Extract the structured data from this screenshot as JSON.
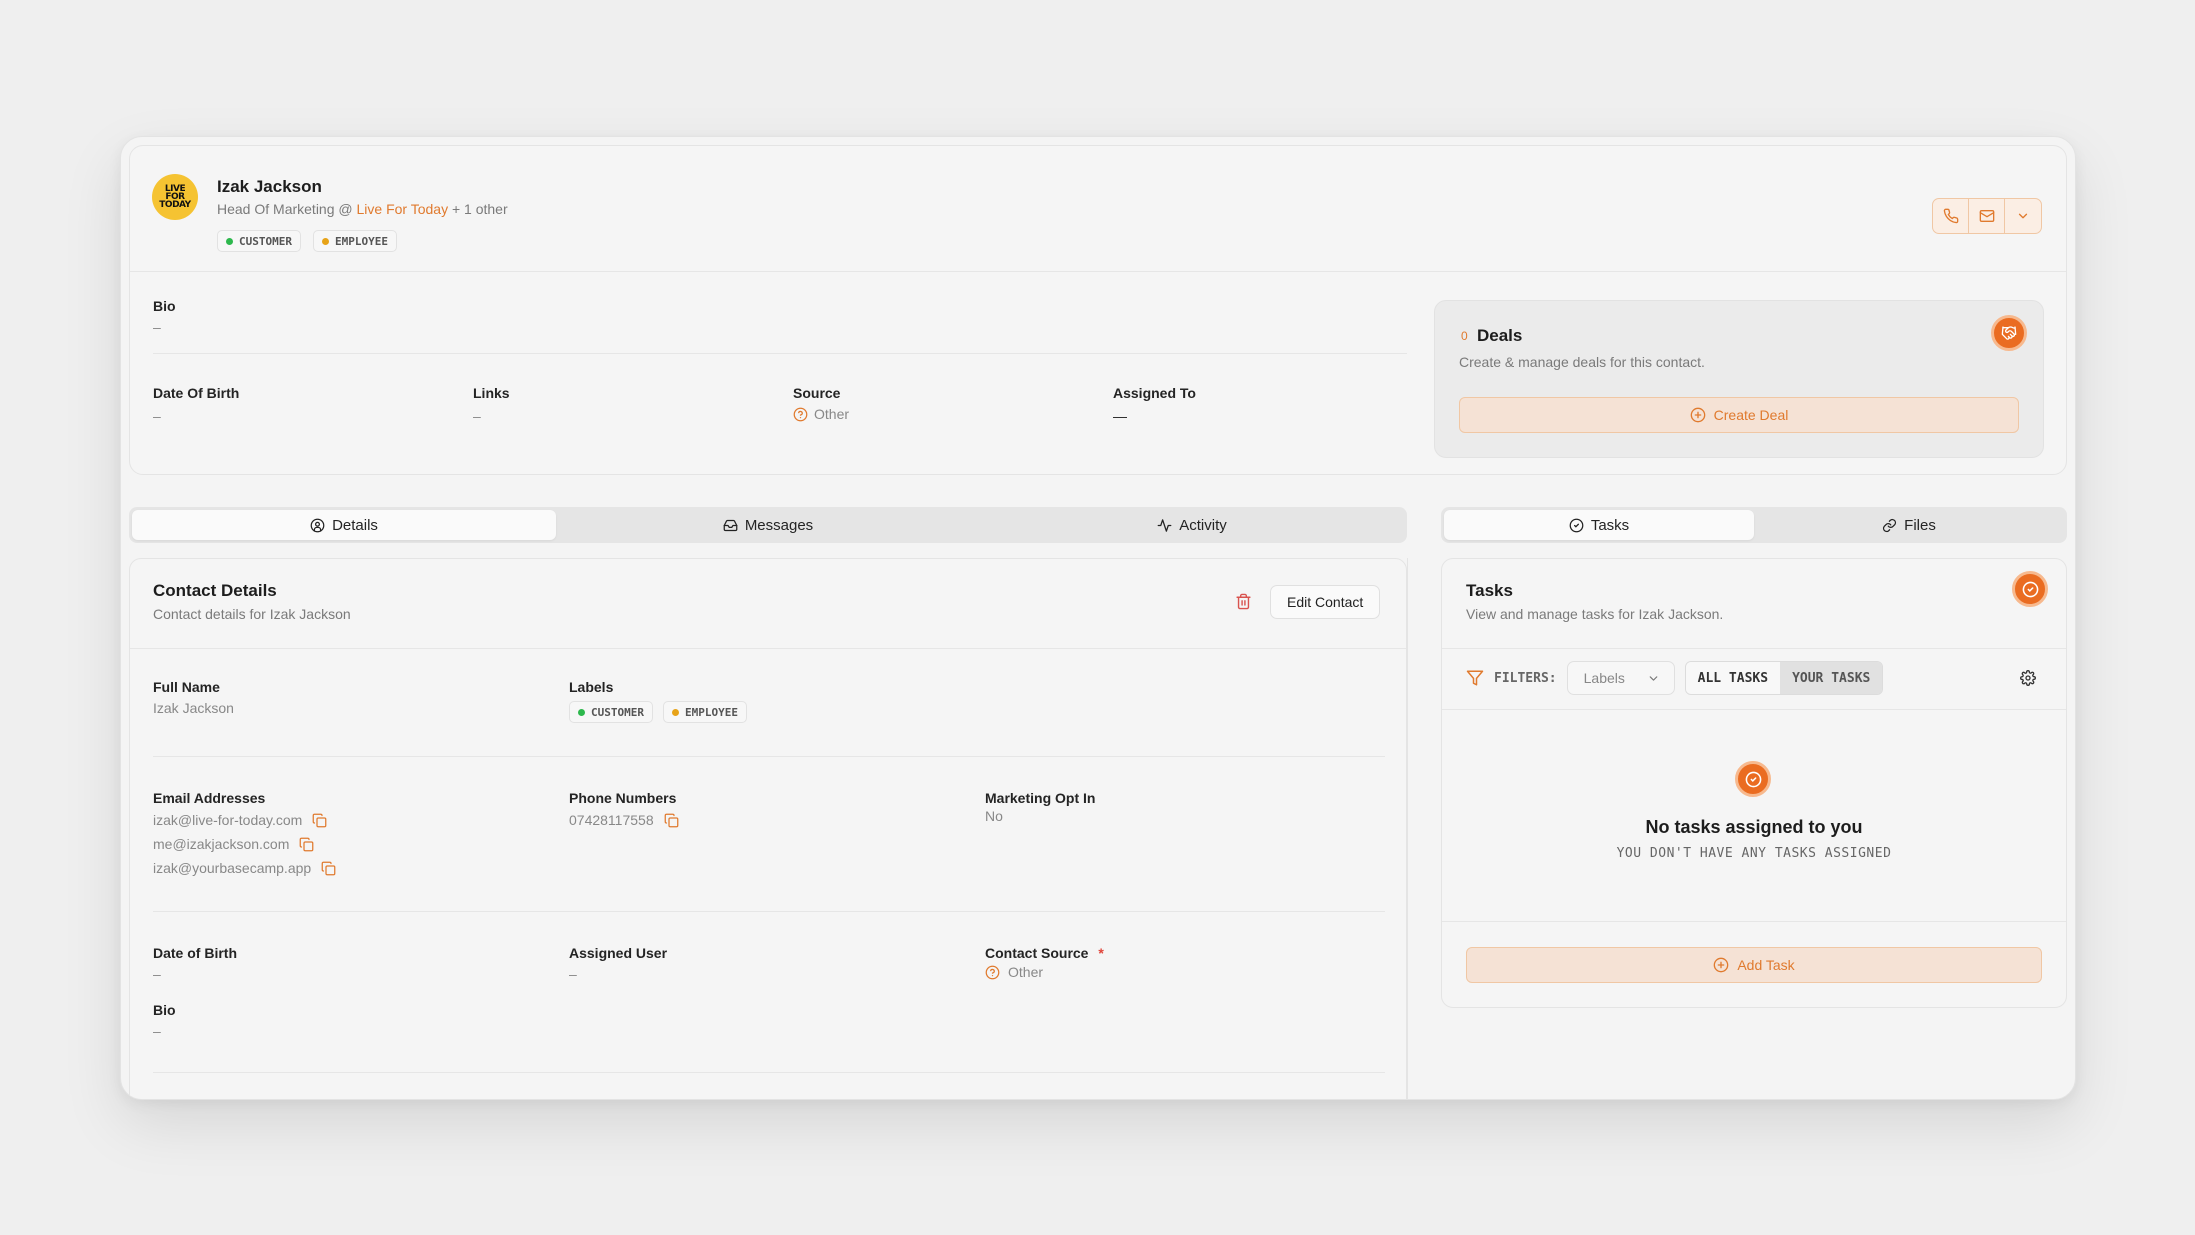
{
  "contact": {
    "name": "Izak Jackson",
    "role_prefix": "Head Of Marketing @ ",
    "company": "Live For Today",
    "role_suffix": " + 1 other",
    "avatar_text": "LIVE FOR TODAY",
    "labels": [
      {
        "text": "CUSTOMER",
        "color": "#2db84d"
      },
      {
        "text": "EMPLOYEE",
        "color": "#e7a318"
      }
    ]
  },
  "header_actions": {
    "icons": [
      "phone-icon",
      "mail-icon",
      "chevron-down-icon"
    ]
  },
  "summary": {
    "bio_label": "Bio",
    "bio_value": "–",
    "dob_label": "Date Of Birth",
    "dob_value": "–",
    "links_label": "Links",
    "links_value": "–",
    "source_label": "Source",
    "source_value": "Other",
    "assigned_label": "Assigned To",
    "assigned_value": "—"
  },
  "deals": {
    "count": "0",
    "title": "Deals",
    "description": "Create & manage deals for this contact.",
    "button": "Create Deal"
  },
  "left_tabs": [
    {
      "label": "Details",
      "icon": "user-circle-icon",
      "active": true
    },
    {
      "label": "Messages",
      "icon": "inbox-icon",
      "active": false
    },
    {
      "label": "Activity",
      "icon": "activity-icon",
      "active": false
    }
  ],
  "right_tabs": [
    {
      "label": "Tasks",
      "icon": "check-circle-icon",
      "active": true
    },
    {
      "label": "Files",
      "icon": "link-icon",
      "active": false
    }
  ],
  "contact_details": {
    "title": "Contact Details",
    "subtitle": "Contact details for Izak Jackson",
    "edit_button": "Edit Contact",
    "full_name_label": "Full Name",
    "full_name_value": "Izak Jackson",
    "labels_label": "Labels",
    "email_label": "Email Addresses",
    "emails": [
      "izak@live-for-today.com",
      "me@izakjackson.com",
      "izak@yourbasecamp.app"
    ],
    "phone_label": "Phone Numbers",
    "phones": [
      "07428117558"
    ],
    "marketing_label": "Marketing Opt In",
    "marketing_value": "No",
    "dob_label": "Date of Birth",
    "dob_value": "–",
    "assigned_label": "Assigned User",
    "assigned_value": "–",
    "source_label": "Contact Source",
    "source_required": "*",
    "source_value": "Other",
    "bio_label": "Bio",
    "bio_value": "–"
  },
  "tasks": {
    "title": "Tasks",
    "subtitle": "View and manage tasks for Izak Jackson.",
    "filters_label": "FILTERS:",
    "labels_select": "Labels",
    "all_tasks": "ALL TASKS",
    "your_tasks": "YOUR TASKS",
    "empty_title": "No tasks assigned to you",
    "empty_sub": "YOU DON'T HAVE ANY TASKS ASSIGNED",
    "add_button": "Add Task"
  },
  "colors": {
    "accent": "#e07a2e",
    "accent_strong": "#ea6c21",
    "customer": "#2db84d",
    "employee": "#e7a318",
    "danger": "#d9534f"
  }
}
